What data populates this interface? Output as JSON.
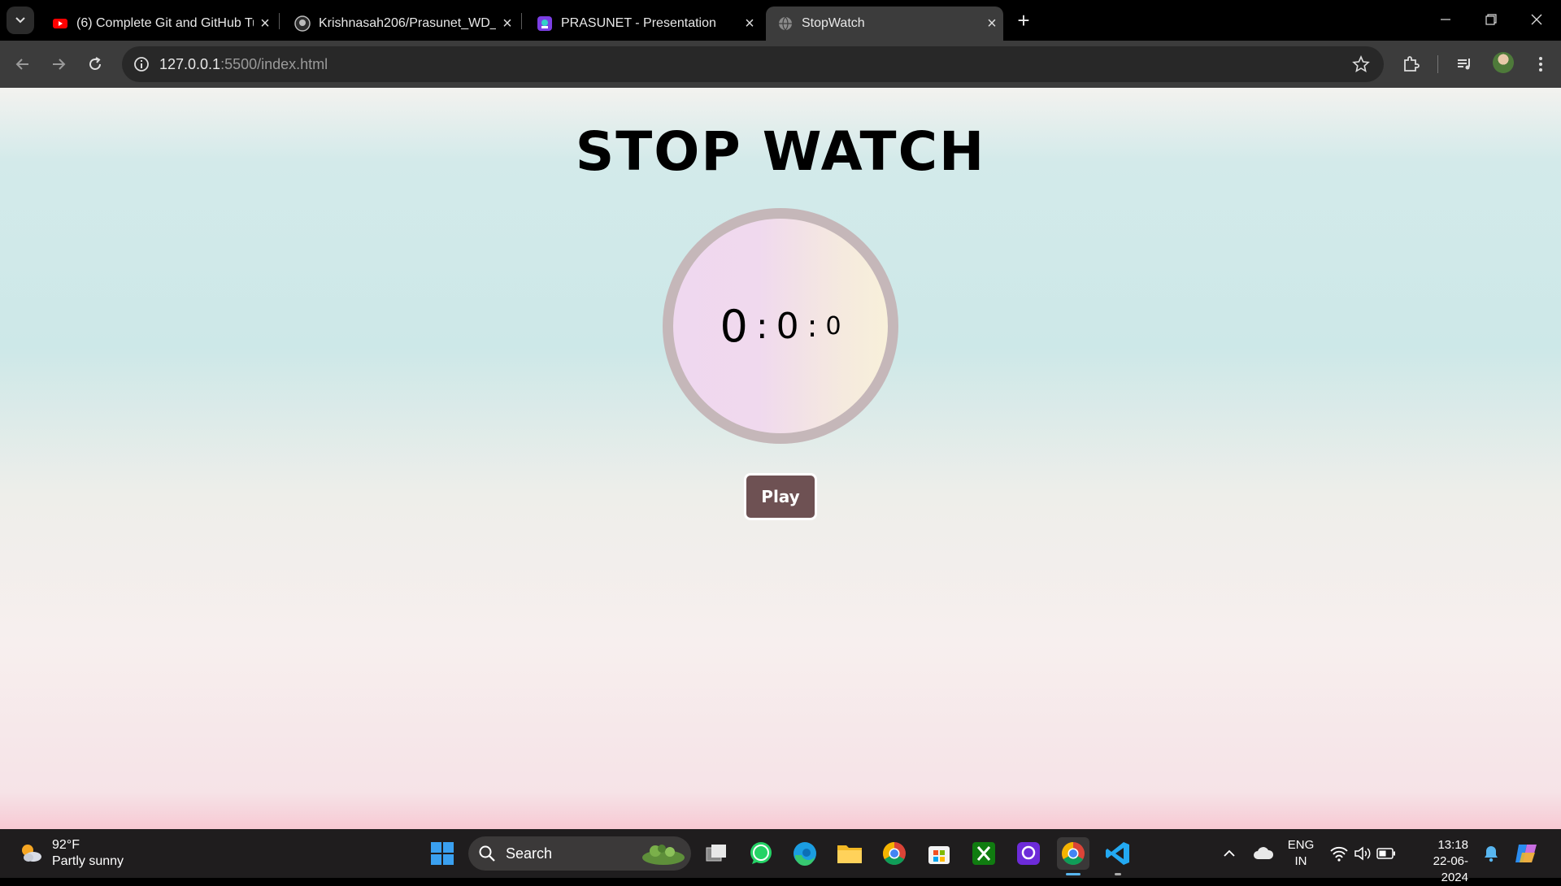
{
  "browser": {
    "tabs": [
      {
        "label": "(6) Complete Git and GitHub Tu",
        "icon": "youtube-icon"
      },
      {
        "label": "Krishnasah206/Prasunet_WD_0:",
        "icon": "github-icon"
      },
      {
        "label": "PRASUNET - Presentation",
        "icon": "canva-icon"
      },
      {
        "label": "StopWatch",
        "icon": "globe-icon",
        "active": true
      }
    ],
    "new_tab_label": "+",
    "url_host": "127.0.0.1",
    "url_rest": ":5500/index.html"
  },
  "page": {
    "title": "STOP WATCH",
    "timer": {
      "hours": "0",
      "minutes": "0",
      "seconds": "0",
      "sep1": ":",
      "sep2": ":"
    },
    "play_label": "Play"
  },
  "taskbar": {
    "weather_temp": "92°F",
    "weather_desc": "Partly sunny",
    "search_label": "Search",
    "lang_line1": "ENG",
    "lang_line2": "IN",
    "time": "13:18",
    "date": "22-06-2024"
  },
  "colors": {
    "play_button": "#6e5153",
    "dial_border": "#c5b7b9",
    "tab_active": "#3c3c3c"
  }
}
